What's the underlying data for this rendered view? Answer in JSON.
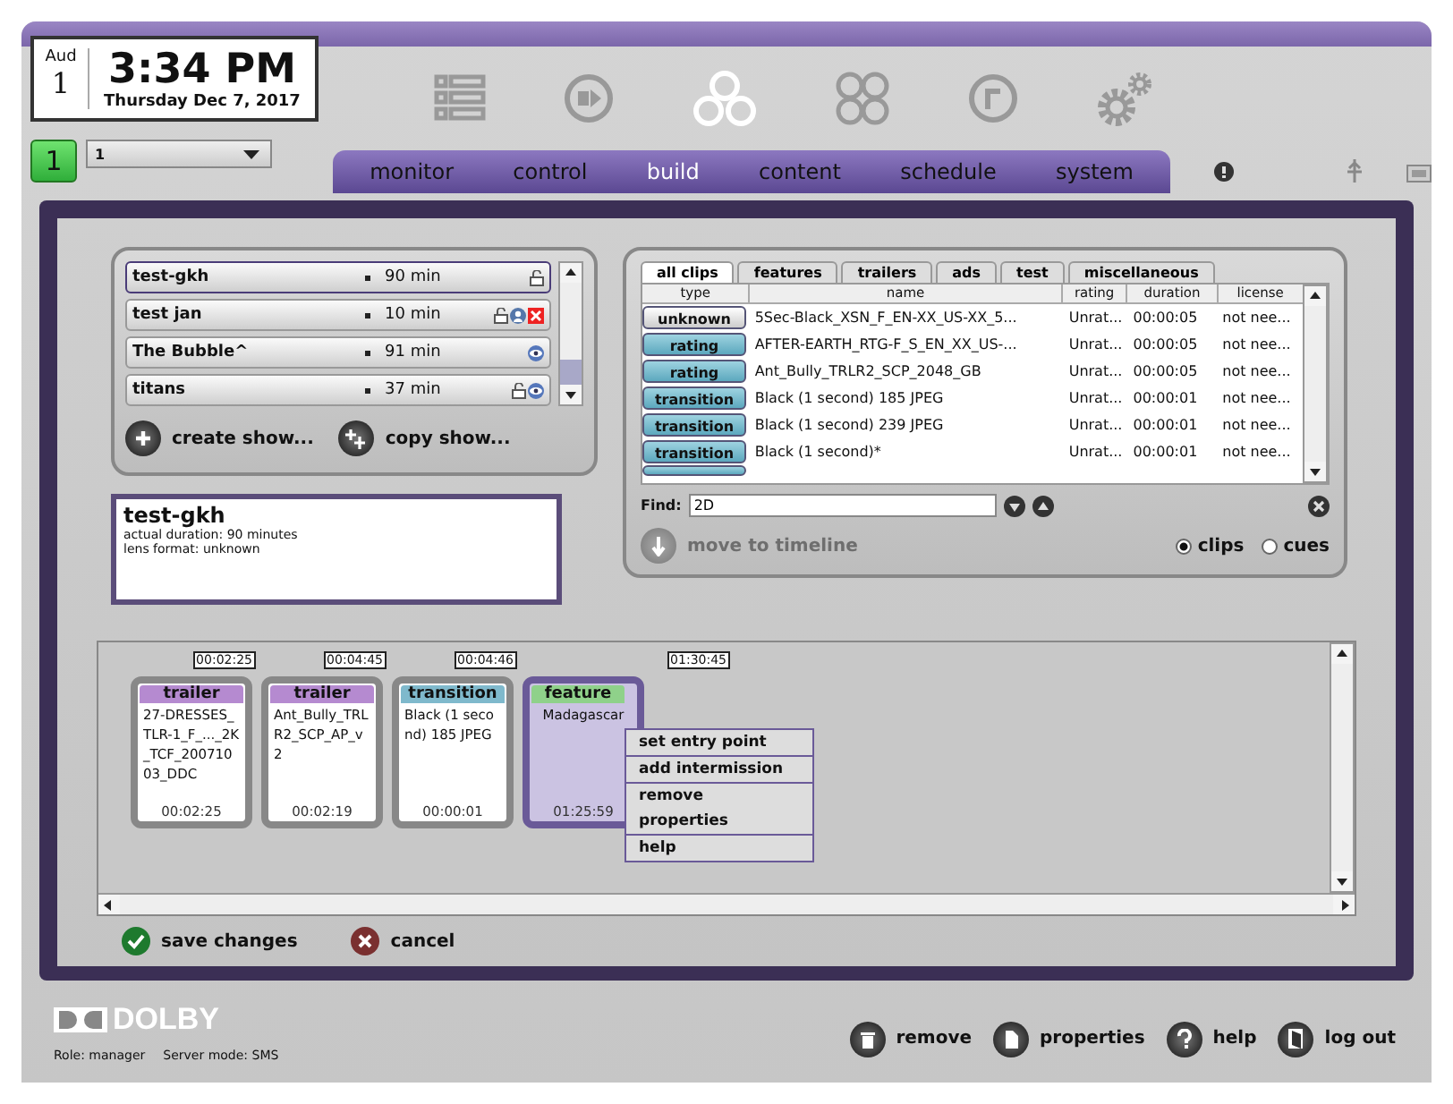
{
  "clock": {
    "aud_label": "Aud",
    "aud_number": "1",
    "time": "3:34 PM",
    "date": "Thursday Dec 7, 2017"
  },
  "screen_badge": "1",
  "screen_select": {
    "value": "1"
  },
  "nav_tabs": [
    {
      "label": "monitor",
      "selected": false
    },
    {
      "label": "control",
      "selected": false
    },
    {
      "label": "build",
      "selected": true
    },
    {
      "label": "content",
      "selected": false
    },
    {
      "label": "schedule",
      "selected": false
    },
    {
      "label": "system",
      "selected": false
    }
  ],
  "shows": [
    {
      "name": "test-gkh",
      "duration": "90 min",
      "selected": true,
      "locked": true,
      "assigned": false,
      "error": false,
      "watched": false
    },
    {
      "name": "test jan",
      "duration": "10 min",
      "selected": false,
      "locked": true,
      "assigned": true,
      "error": true,
      "watched": false
    },
    {
      "name": "The Bubble^",
      "duration": "91 min",
      "selected": false,
      "locked": false,
      "assigned": false,
      "error": false,
      "watched": true
    },
    {
      "name": "titans",
      "duration": "37 min",
      "selected": false,
      "locked": true,
      "assigned": false,
      "error": false,
      "watched": true
    }
  ],
  "show_actions": [
    {
      "label": "create show...",
      "kind": "create"
    },
    {
      "label": "copy show...",
      "kind": "copy"
    }
  ],
  "show_info": {
    "title": "test-gkh",
    "lines": [
      "actual duration: 90 minutes",
      "lens format: unknown"
    ]
  },
  "clip_tabs": [
    {
      "label": "all clips",
      "selected": true
    },
    {
      "label": "features",
      "selected": false
    },
    {
      "label": "trailers",
      "selected": false
    },
    {
      "label": "ads",
      "selected": false
    },
    {
      "label": "test",
      "selected": false
    },
    {
      "label": "miscellaneous",
      "selected": false
    }
  ],
  "clip_columns": [
    "type",
    "name",
    "rating",
    "duration",
    "license"
  ],
  "clip_rows": [
    {
      "type": "unknown",
      "kind": "unknown",
      "name": "5Sec-Black_XSN_F_EN-XX_US-XX_5...",
      "rating": "Unrat...",
      "duration": "00:00:05",
      "license": "not nee..."
    },
    {
      "type": "rating",
      "kind": "known",
      "name": "AFTER-EARTH_RTG-F_S_EN_XX_US-...",
      "rating": "Unrat...",
      "duration": "00:00:05",
      "license": "not nee..."
    },
    {
      "type": "rating",
      "kind": "known",
      "name": "Ant_Bully_TRLR2_SCP_2048_GB",
      "rating": "Unrat...",
      "duration": "00:00:05",
      "license": "not nee..."
    },
    {
      "type": "transition",
      "kind": "known",
      "name": "Black (1 second) 185 JPEG",
      "rating": "Unrat...",
      "duration": "00:00:01",
      "license": "not nee..."
    },
    {
      "type": "transition",
      "kind": "known",
      "name": "Black (1 second) 239 JPEG",
      "rating": "Unrat...",
      "duration": "00:00:01",
      "license": "not nee..."
    },
    {
      "type": "transition",
      "kind": "known",
      "name": "Black (1 second)*",
      "rating": "Unrat...",
      "duration": "00:00:01",
      "license": "not nee..."
    }
  ],
  "find": {
    "label": "Find:",
    "value": "2D"
  },
  "move_button": {
    "label": "move to timeline",
    "disabled": true
  },
  "view_radios": [
    {
      "label": "clips",
      "selected": true
    },
    {
      "label": "cues",
      "selected": false
    }
  ],
  "timeline": [
    {
      "marker": "00:02:25",
      "kind": "trailer",
      "type": "trailer",
      "name": "27-DRESSES_TLR-1_F_..._2K_TCF_20071003_DDC",
      "duration": "00:02:25",
      "selected": false
    },
    {
      "marker": "00:04:45",
      "kind": "trailer",
      "type": "trailer",
      "name": "Ant_Bully_TRLR2_SCP_AP_v2",
      "duration": "00:02:19",
      "selected": false
    },
    {
      "marker": "00:04:46",
      "kind": "transition",
      "type": "transition",
      "name": "Black (1 second) 185 JPEG",
      "duration": "00:00:01",
      "selected": false
    },
    {
      "marker": "01:30:45",
      "kind": "feature",
      "type": "feature",
      "name": "Madagascar",
      "duration": "01:25:59",
      "selected": true
    }
  ],
  "context_menu": [
    [
      "set entry point"
    ],
    [
      "add intermission"
    ],
    [
      "remove",
      "properties"
    ],
    [
      "help"
    ]
  ],
  "edit_actions": [
    {
      "label": "save changes",
      "kind": "save"
    },
    {
      "label": "cancel",
      "kind": "cancel"
    }
  ],
  "logo": "DOLBY",
  "status": [
    "Role: manager",
    "Server mode: SMS"
  ],
  "footer_actions": [
    {
      "label": "remove",
      "kind": "remove"
    },
    {
      "label": "properties",
      "kind": "properties"
    },
    {
      "label": "help",
      "kind": "help"
    },
    {
      "label": "log out",
      "kind": "logout"
    }
  ]
}
